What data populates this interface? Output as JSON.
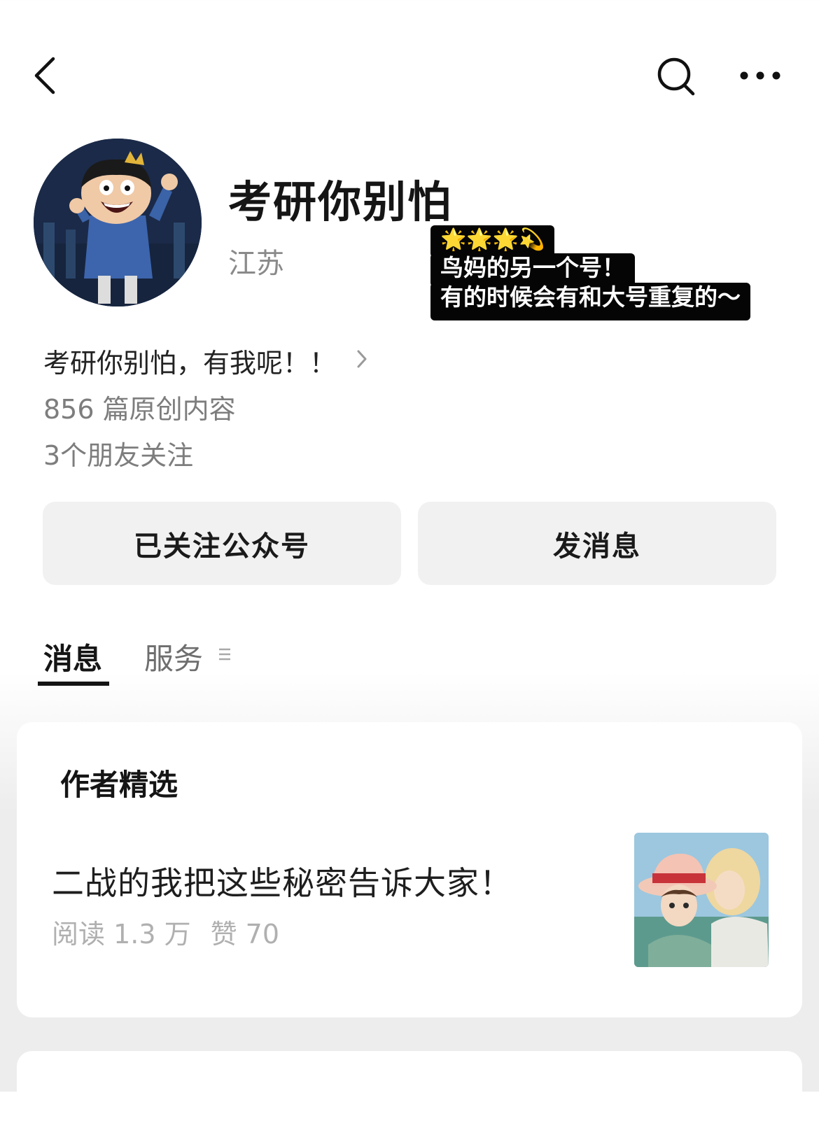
{
  "nav": {
    "back_icon": "chevron-left-icon",
    "search_icon": "search-icon",
    "more_icon": "more-horizontal-icon"
  },
  "profile": {
    "name": "考研你别怕",
    "region": "江苏",
    "sticker": {
      "line1": "🌟🌟🌟💫",
      "line2": "鸟妈的另一个号！",
      "line3": "有的时候会有和大号重复的～"
    },
    "bio": "考研你别怕，有我呢！！",
    "original_count": "856 篇原创内容",
    "friends_following": "3个朋友关注"
  },
  "actions": {
    "follow_label": "已关注公众号",
    "message_label": "发消息"
  },
  "tabs": [
    {
      "label": "消息",
      "active": true
    },
    {
      "label": "服务",
      "active": false
    }
  ],
  "featured": {
    "section_title": "作者精选",
    "articles": [
      {
        "title": "二战的我把这些秘密告诉大家！",
        "reads": "阅读 1.3 万",
        "likes": "赞 70"
      }
    ]
  },
  "colors": {
    "text_primary": "#151515",
    "text_secondary": "#7d7d7d",
    "button_bg": "#f1f1f1",
    "page_bg": "#ededed"
  }
}
